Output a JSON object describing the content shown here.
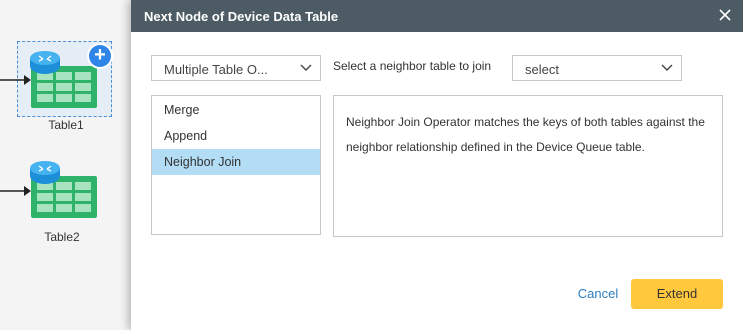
{
  "canvas": {
    "nodes": [
      {
        "label": "Table1"
      },
      {
        "label": "Table2"
      }
    ]
  },
  "dialog": {
    "title": "Next Node of Device Data Table",
    "operation_select": {
      "value": "Multiple Table O..."
    },
    "join_label": "Select a neighbor table to join",
    "neighbor_select": {
      "value": "select"
    },
    "operations": [
      {
        "label": "Merge",
        "selected": false
      },
      {
        "label": "Append",
        "selected": false
      },
      {
        "label": "Neighbor Join",
        "selected": true
      }
    ],
    "description": "Neighbor Join Operator matches the keys of both tables against the neighbor relationship defined in the Device Queue table.",
    "cancel_label": "Cancel",
    "extend_label": "Extend"
  },
  "colors": {
    "header_bg": "#4d5b65",
    "selected_item_bg": "#b3dcf5",
    "extend_button": "#ffc83d",
    "cancel_link": "#2d7fc0",
    "table_green": "#2fb36b",
    "add_badge": "#2f86e8"
  }
}
